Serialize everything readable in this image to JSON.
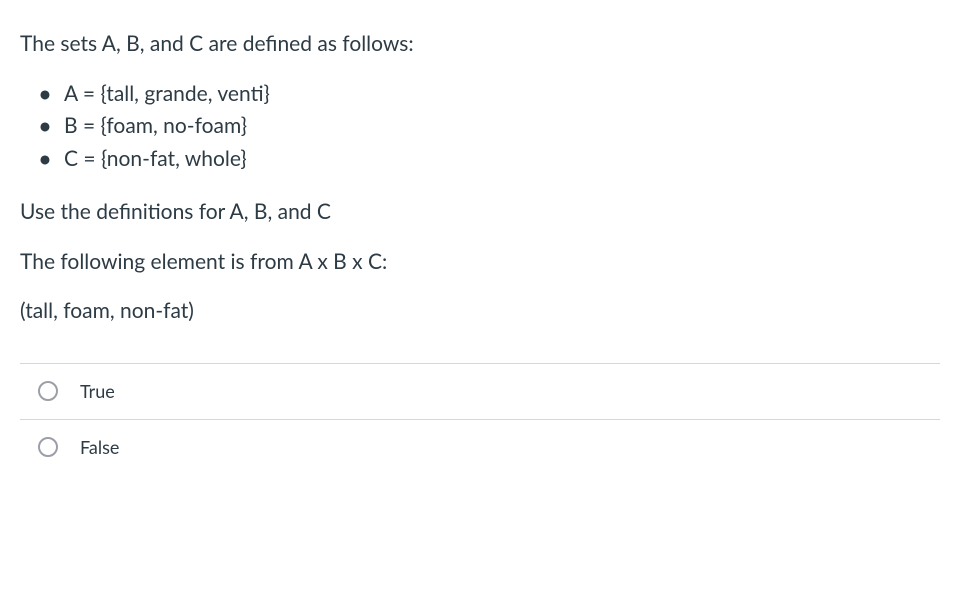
{
  "question": {
    "intro": "The sets A, B, and C are defined as follows:",
    "items": [
      "A = {tall, grande, venti}",
      "B = {foam, no-foam}",
      "C = {non-fat, whole}"
    ],
    "instruction": "Use the definitions for A, B, and C",
    "prompt": "The following element is from  A x B x C:",
    "element": "(tall, foam, non-fat)"
  },
  "options": {
    "true_label": "True",
    "false_label": "False"
  }
}
